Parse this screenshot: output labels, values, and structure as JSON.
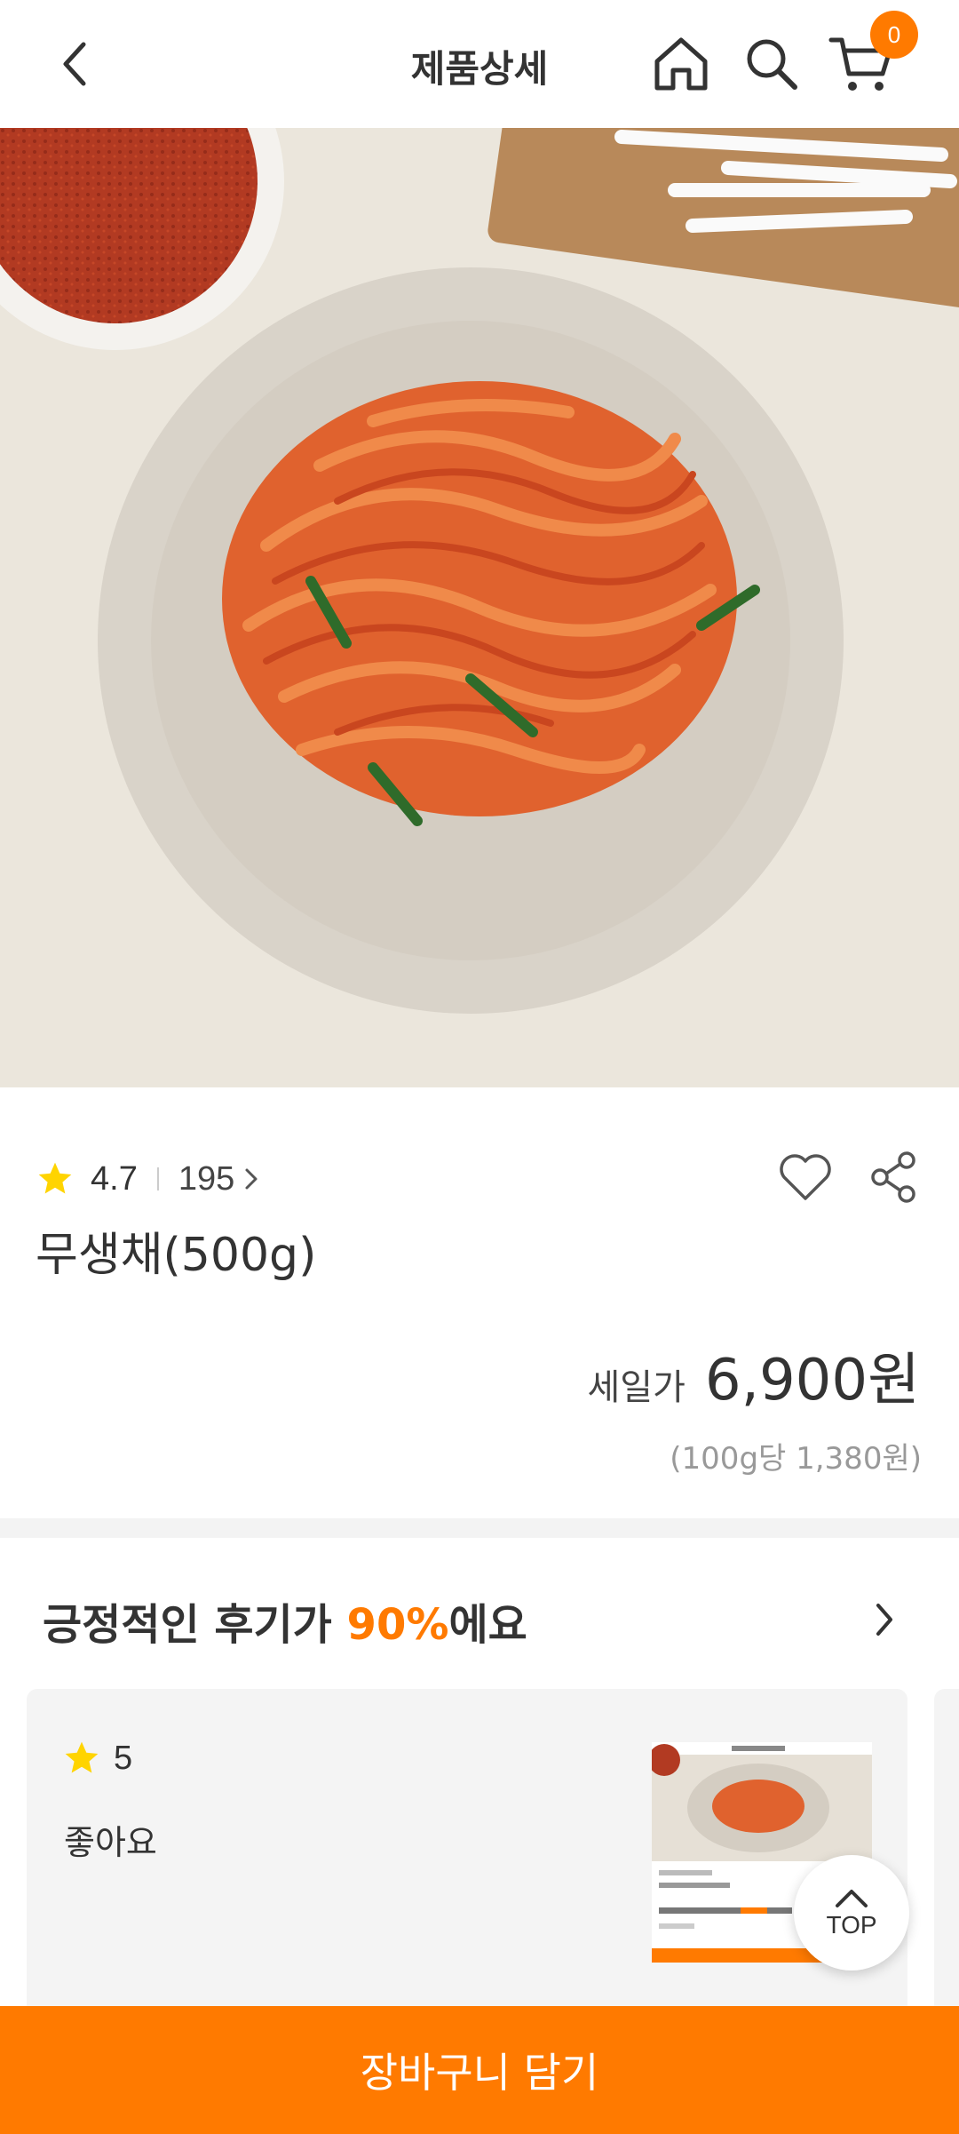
{
  "header": {
    "title": "제품상세",
    "cart_count": "0",
    "icons": [
      "back-arrow-icon",
      "home-icon",
      "search-icon",
      "cart-icon"
    ]
  },
  "product": {
    "rating": "4.7",
    "review_count": "195",
    "name": "무생채(500g)",
    "price_label": "세일가",
    "price": "6,900원",
    "unit_price": "(100g당 1,380원)"
  },
  "reviews": {
    "title_prefix": "긍정적인 후기가 ",
    "title_percent": "90%",
    "title_suffix": "에요",
    "items": [
      {
        "score": "5",
        "text": "좋아요"
      }
    ]
  },
  "top_button": {
    "label": "TOP"
  },
  "cta": {
    "label": "장바구니 담기"
  },
  "colors": {
    "accent": "#ff7a00",
    "star": "#ffd400",
    "background": "#ffffff",
    "divider": "#f3f3f3"
  }
}
